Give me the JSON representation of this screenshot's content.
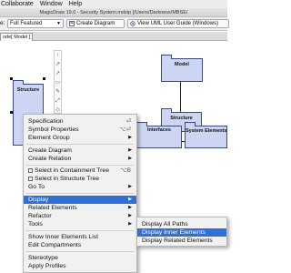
{
  "menubar": {
    "items": [
      "Collaborate",
      "Window",
      "Help"
    ]
  },
  "window": {
    "title": "MagicDraw 19.0 - Security System.mdzip [/Users/Darkness/MBSE/"
  },
  "toolbar": {
    "perspective_label": "e:",
    "perspective_value": "Full Featured",
    "create_diagram_label": "Create Diagram",
    "uml_guide_label": "View UML User Guide (Windows)"
  },
  "tabs": {
    "diagram_tab": "ode[ Model ]"
  },
  "canvas": {
    "packages": {
      "structure_left": "Structure",
      "model": "Model",
      "structure_right": "Structure",
      "interfaces": "Interfaces",
      "system_elements": "System Elements"
    },
    "diagram_toolbar_icons": [
      "up-arrow-icon",
      "arrow-icon",
      "arrow-icon",
      "note-icon",
      "pen-icon",
      "link-icon",
      "shape-icon"
    ]
  },
  "context_menu": {
    "specification": "Specification",
    "specification_shortcut": "⏎",
    "symbol_properties": "Symbol Properties",
    "symbol_properties_shortcut": "⌥⏎",
    "element_group": "Element Group",
    "create_diagram": "Create Diagram",
    "create_relation": "Create Relation",
    "select_containment": "Select in Containment Tree",
    "select_containment_shortcut": "⌥B",
    "select_structure": "Select in Structure Tree",
    "go_to": "Go To",
    "display": "Display",
    "related_elements": "Related Elements",
    "refactor": "Refactor",
    "tools": "Tools",
    "show_inner_list": "Show Inner Elements List",
    "edit_compartments": "Edit Compartments",
    "stereotype": "Stereotype",
    "apply_profiles": "Apply Profiles"
  },
  "display_submenu": {
    "display_all_paths": "Display All Paths",
    "display_inner_elements": "Display Inner Elements",
    "display_related_elements": "Display Related Elements"
  },
  "colors": {
    "package_fill": "#ccd6f2",
    "highlight": "#2f6fd6"
  }
}
